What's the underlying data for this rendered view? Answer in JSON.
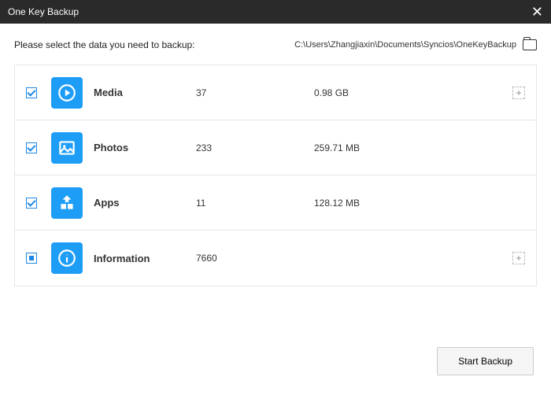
{
  "window": {
    "title": "One Key Backup"
  },
  "header": {
    "instructions": "Please select the data you need to backup:",
    "path": "C:\\Users\\Zhangjiaxin\\Documents\\Syncios\\OneKeyBackup"
  },
  "items": [
    {
      "id": "media",
      "label": "Media",
      "count": "37",
      "size": "0.98 GB",
      "checked": true,
      "expandable": true,
      "icon": "play"
    },
    {
      "id": "photos",
      "label": "Photos",
      "count": "233",
      "size": "259.71 MB",
      "checked": true,
      "expandable": false,
      "icon": "photo"
    },
    {
      "id": "apps",
      "label": "Apps",
      "count": "11",
      "size": "128.12 MB",
      "checked": true,
      "expandable": false,
      "icon": "apps"
    },
    {
      "id": "information",
      "label": "Information",
      "count": "7660",
      "size": "",
      "checked": "indeterminate",
      "expandable": true,
      "icon": "info"
    }
  ],
  "footer": {
    "start_label": "Start Backup"
  }
}
